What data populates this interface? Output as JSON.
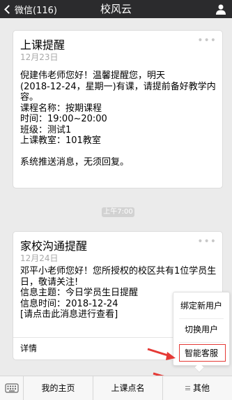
{
  "nav": {
    "back_label": "微信(116)",
    "title": "校风云"
  },
  "messages": [
    {
      "title": "上课提醒",
      "date": "12月23日",
      "dots": "•••",
      "lines": [
        "倪建伟老师您好！温馨提醒您，明天",
        "(2018-12-24，星期一)有课，请提前备好教学内",
        "容。",
        "课程名称：按期课程",
        "时间：19:00~20:00",
        "班级：测试1",
        "上课教室：101教室",
        "",
        "系统推送消息，无须回复。"
      ]
    },
    {
      "title": "家校沟通提醒",
      "date": "12月24日",
      "dots": "•••",
      "lines": [
        "邓平小老师您好！您所授权的校区共有1位学员生",
        "日，敬请关注!",
        "信息主题：今日学员生日提醒",
        "信息时间：2018-12-24",
        "[请点击此消息进行查看]"
      ],
      "detail_label": "详情"
    }
  ],
  "time_badge": "上午7:00",
  "popup_menu": {
    "items": [
      "绑定新用户",
      "切换用户",
      "智能客服"
    ]
  },
  "tabbar": {
    "items": [
      "我的主页",
      "上课点名",
      "其他"
    ]
  },
  "colors": {
    "navbar": "#2b2b2d",
    "highlight": "#e53935",
    "background": "#ebebeb"
  }
}
